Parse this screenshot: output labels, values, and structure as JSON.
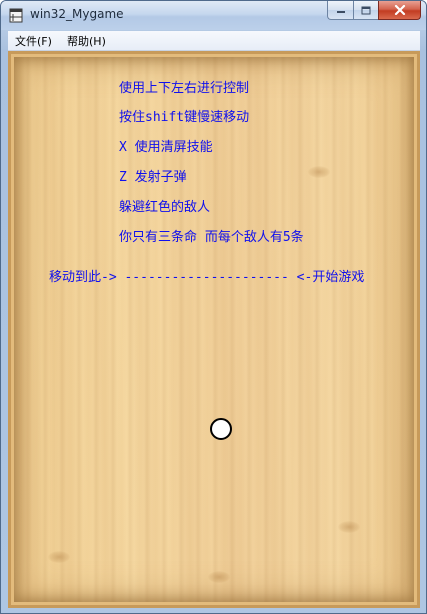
{
  "window": {
    "title": "win32_Mygame",
    "app_icon": "window-app-icon",
    "caption_buttons": [
      "minimize-icon",
      "maximize-icon",
      "close-icon"
    ]
  },
  "menu": {
    "items": [
      "文件(F)",
      "帮助(H)"
    ]
  },
  "game": {
    "instructions": [
      "使用上下左右进行控制",
      "按住shift键慢速移动",
      "X 使用清屏技能",
      "Z 发射子弹",
      "躲避红色的敌人",
      "你只有三条命 而每个敌人有5条"
    ],
    "start_line": "移动到此-> --------------------- <-开始游戏",
    "text_color": "#1010ee",
    "player_shape": "circle"
  }
}
